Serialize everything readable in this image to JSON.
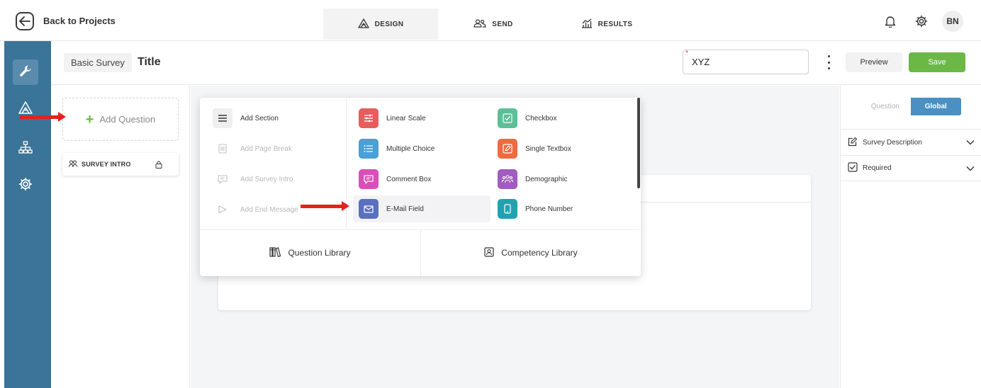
{
  "topbar": {
    "back_label": "Back to Projects",
    "tabs": [
      {
        "label": "DESIGN",
        "icon": "design-icon",
        "active": true
      },
      {
        "label": "SEND",
        "icon": "people-icon",
        "active": false
      },
      {
        "label": "RESULTS",
        "icon": "chart-icon",
        "active": false
      }
    ],
    "avatar_initials": "BN"
  },
  "rail": {
    "items": [
      {
        "icon": "wrench-icon",
        "active": true
      },
      {
        "icon": "design-icon",
        "active": false
      },
      {
        "icon": "hierarchy-icon",
        "active": false
      },
      {
        "icon": "gear-icon",
        "active": false
      }
    ]
  },
  "header": {
    "survey_type": "Basic Survey",
    "title": "Title",
    "name_value": "XYZ",
    "preview_label": "Preview",
    "save_label": "Save"
  },
  "left_panel": {
    "add_question_label": "Add Question",
    "survey_intro_label": "SURVEY INTRO"
  },
  "menu": {
    "left_items": [
      {
        "label": "Add Section",
        "icon": "lines-icon",
        "enabled": true
      },
      {
        "label": "Add Page Break",
        "icon": "page-break-icon",
        "enabled": false
      },
      {
        "label": "Add Survey Intro",
        "icon": "intro-icon",
        "enabled": false
      },
      {
        "label": "Add End Message",
        "icon": "flag-icon",
        "enabled": false
      }
    ],
    "question_types": [
      {
        "label": "Linear Scale",
        "icon": "sliders-icon",
        "color": "#e95c5c"
      },
      {
        "label": "Checkbox",
        "icon": "checkbox-icon",
        "color": "#5bbf97"
      },
      {
        "label": "Multiple Choice",
        "icon": "list-icon",
        "color": "#4a9fd6"
      },
      {
        "label": "Single Textbox",
        "icon": "pencil-icon",
        "color": "#ee6a3f"
      },
      {
        "label": "Comment Box",
        "icon": "comment-icon",
        "color": "#d94fb8"
      },
      {
        "label": "Demographic",
        "icon": "group-icon",
        "color": "#a05cc0"
      },
      {
        "label": "E-Mail Field",
        "icon": "mail-icon",
        "color": "#5a6fbf"
      },
      {
        "label": "Phone Number",
        "icon": "phone-icon",
        "color": "#1fa3b0"
      }
    ],
    "library_buttons": [
      {
        "label": "Question Library",
        "icon": "books-icon"
      },
      {
        "label": "Competency Library",
        "icon": "badge-icon"
      }
    ]
  },
  "right_panel": {
    "toggle": {
      "question_label": "Question",
      "global_label": "Global",
      "active": "Global"
    },
    "sections": [
      {
        "label": "Survey Description",
        "icon": "edit-icon"
      },
      {
        "label": "Required",
        "icon": "checked-box-icon"
      }
    ]
  },
  "colors": {
    "rail": "#3b7499",
    "save_green": "#6cb847",
    "global_blue": "#4a90c2",
    "annotation_red": "#e3231b"
  }
}
